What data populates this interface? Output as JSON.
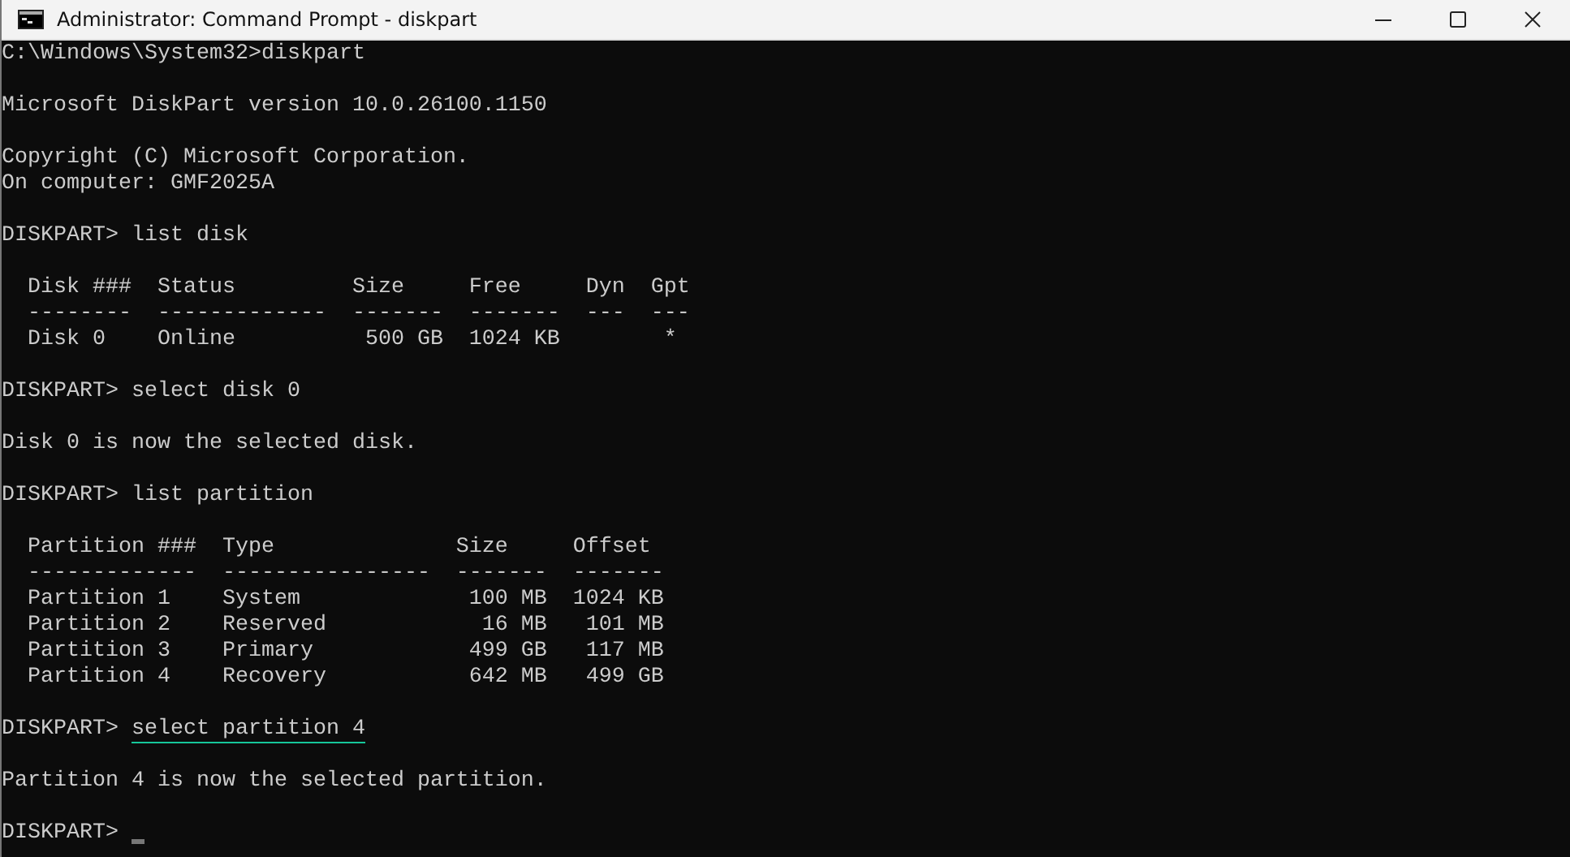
{
  "window": {
    "title": "Administrator: Command Prompt - diskpart",
    "buttons": [
      {
        "kind": "minimize"
      },
      {
        "kind": "maximize"
      },
      {
        "kind": "close"
      }
    ]
  },
  "console": {
    "blocks": [
      [
        {
          "kind": "output",
          "text": "C:\\Windows\\System32>diskpart"
        }
      ],
      [
        {
          "kind": "output",
          "text": "Microsoft DiskPart version 10.0.26100.1150"
        }
      ],
      [
        {
          "kind": "output",
          "text": "Copyright (C) Microsoft Corporation."
        },
        {
          "kind": "output",
          "text": "On computer: GMF2025A"
        }
      ],
      [
        {
          "kind": "prompt",
          "prompt": "DISKPART>",
          "command": "list disk",
          "underlined": false
        }
      ],
      [
        {
          "kind": "output",
          "text": "  Disk ###  Status         Size     Free     Dyn  Gpt"
        },
        {
          "kind": "output",
          "text": "  --------  -------------  -------  -------  ---  ---"
        },
        {
          "kind": "output",
          "text": "  Disk 0    Online          500 GB  1024 KB        *"
        }
      ],
      [
        {
          "kind": "prompt",
          "prompt": "DISKPART>",
          "command": "select disk 0",
          "underlined": false
        }
      ],
      [
        {
          "kind": "output",
          "text": "Disk 0 is now the selected disk."
        }
      ],
      [
        {
          "kind": "prompt",
          "prompt": "DISKPART>",
          "command": "list partition",
          "underlined": false
        }
      ],
      [
        {
          "kind": "output",
          "text": "  Partition ###  Type              Size     Offset"
        },
        {
          "kind": "output",
          "text": "  -------------  ----------------  -------  -------"
        },
        {
          "kind": "output",
          "text": "  Partition 1    System             100 MB  1024 KB"
        },
        {
          "kind": "output",
          "text": "  Partition 2    Reserved            16 MB   101 MB"
        },
        {
          "kind": "output",
          "text": "  Partition 3    Primary            499 GB   117 MB"
        },
        {
          "kind": "output",
          "text": "  Partition 4    Recovery           642 MB   499 GB"
        }
      ],
      [
        {
          "kind": "prompt",
          "prompt": "DISKPART>",
          "command": "select partition 4",
          "underlined": true
        }
      ],
      [
        {
          "kind": "output",
          "text": "Partition 4 is now the selected partition."
        }
      ],
      [
        {
          "kind": "prompt",
          "prompt": "DISKPART>",
          "underlined": false,
          "cursor": true
        }
      ]
    ]
  }
}
